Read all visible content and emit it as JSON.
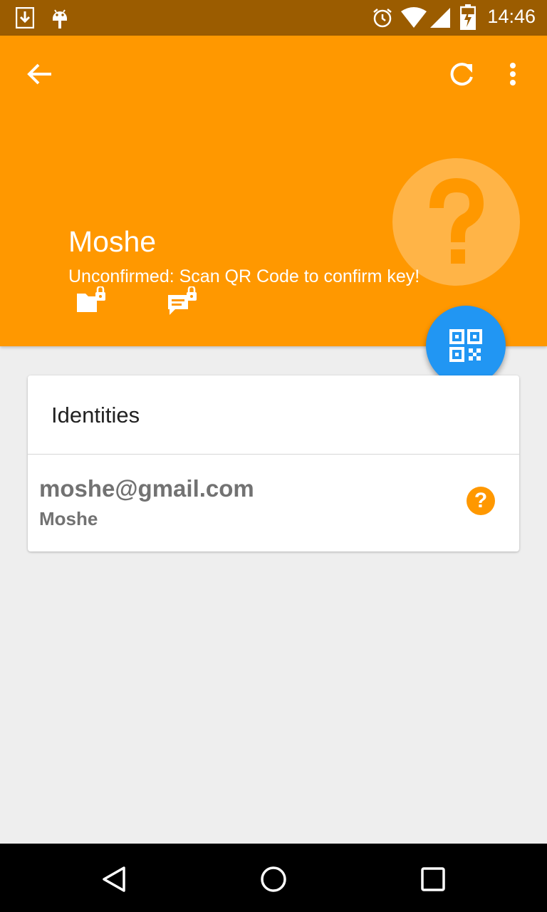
{
  "status_bar": {
    "time": "14:46",
    "icons": [
      "download-icon",
      "android-debug-icon",
      "alarm-icon",
      "wifi-icon",
      "signal-icon",
      "battery-charging-icon"
    ]
  },
  "toolbar": {
    "back_icon": "arrow-left-icon",
    "refresh_icon": "refresh-icon",
    "overflow_icon": "more-vert-icon"
  },
  "contact": {
    "name": "Moshe",
    "status": "Unconfirmed: Scan QR Code to confirm key!",
    "status_icon": "help-circle-icon",
    "action_icons": [
      "encrypted-file-icon",
      "encrypted-message-icon"
    ]
  },
  "fab": {
    "icon": "qr-code-icon",
    "color": "#2196f3"
  },
  "identities": {
    "title": "Identities",
    "items": [
      {
        "email": "moshe@gmail.com",
        "name": "Moshe",
        "status_glyph": "?"
      }
    ]
  },
  "nav_bar": {
    "buttons": [
      "back-triangle-icon",
      "home-circle-icon",
      "recents-square-icon"
    ]
  },
  "colors": {
    "primary": "#ff9800",
    "primary_dark": "#9b5c00",
    "accent": "#2196f3",
    "background": "#eeeeee"
  }
}
